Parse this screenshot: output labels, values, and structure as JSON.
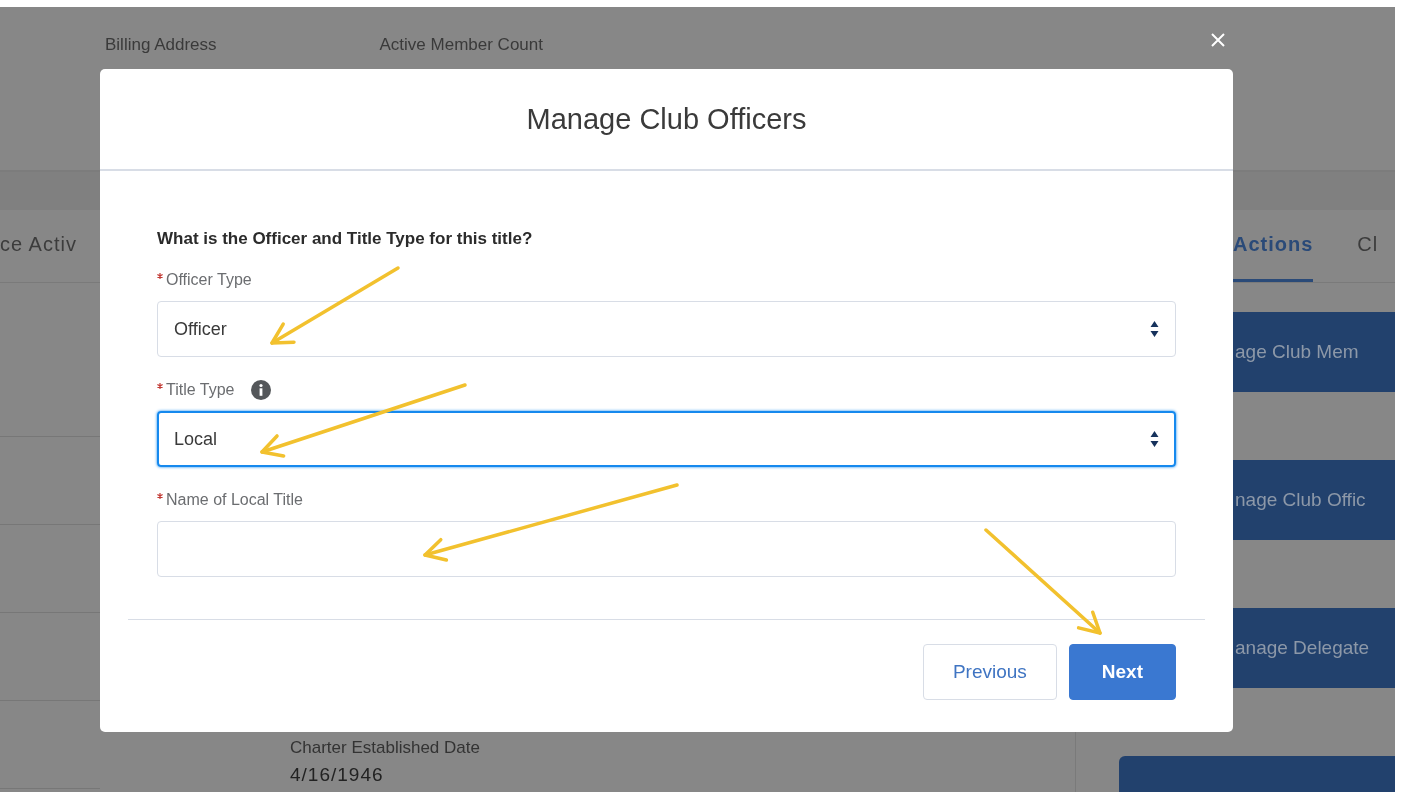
{
  "background": {
    "header_fields": [
      "Billing Address",
      "Active Member Count"
    ],
    "tabs": [
      {
        "label": "ce Activ",
        "selected": false
      },
      {
        "label": "Actions",
        "selected": true
      },
      {
        "label": "Cl",
        "selected": false
      }
    ],
    "action_buttons": [
      "age Club Mem",
      "nage Club Offic",
      "anage Delegate"
    ],
    "detail": {
      "label": "Charter Established Date",
      "value": "4/16/1946"
    }
  },
  "modal": {
    "title": "Manage Club Officers",
    "question": "What is the Officer and Title Type for this title?",
    "fields": [
      {
        "label": "Officer Type",
        "kind": "select",
        "required": true,
        "info": false,
        "focused": false,
        "value": "Officer"
      },
      {
        "label": "Title Type",
        "kind": "select",
        "required": true,
        "info": true,
        "focused": true,
        "value": "Local"
      },
      {
        "label": "Name of Local Title",
        "kind": "text",
        "required": true,
        "info": false,
        "focused": false
      }
    ],
    "buttons": [
      {
        "label": "Previous",
        "kind": "neutral"
      },
      {
        "label": "Next",
        "kind": "brand"
      }
    ]
  }
}
